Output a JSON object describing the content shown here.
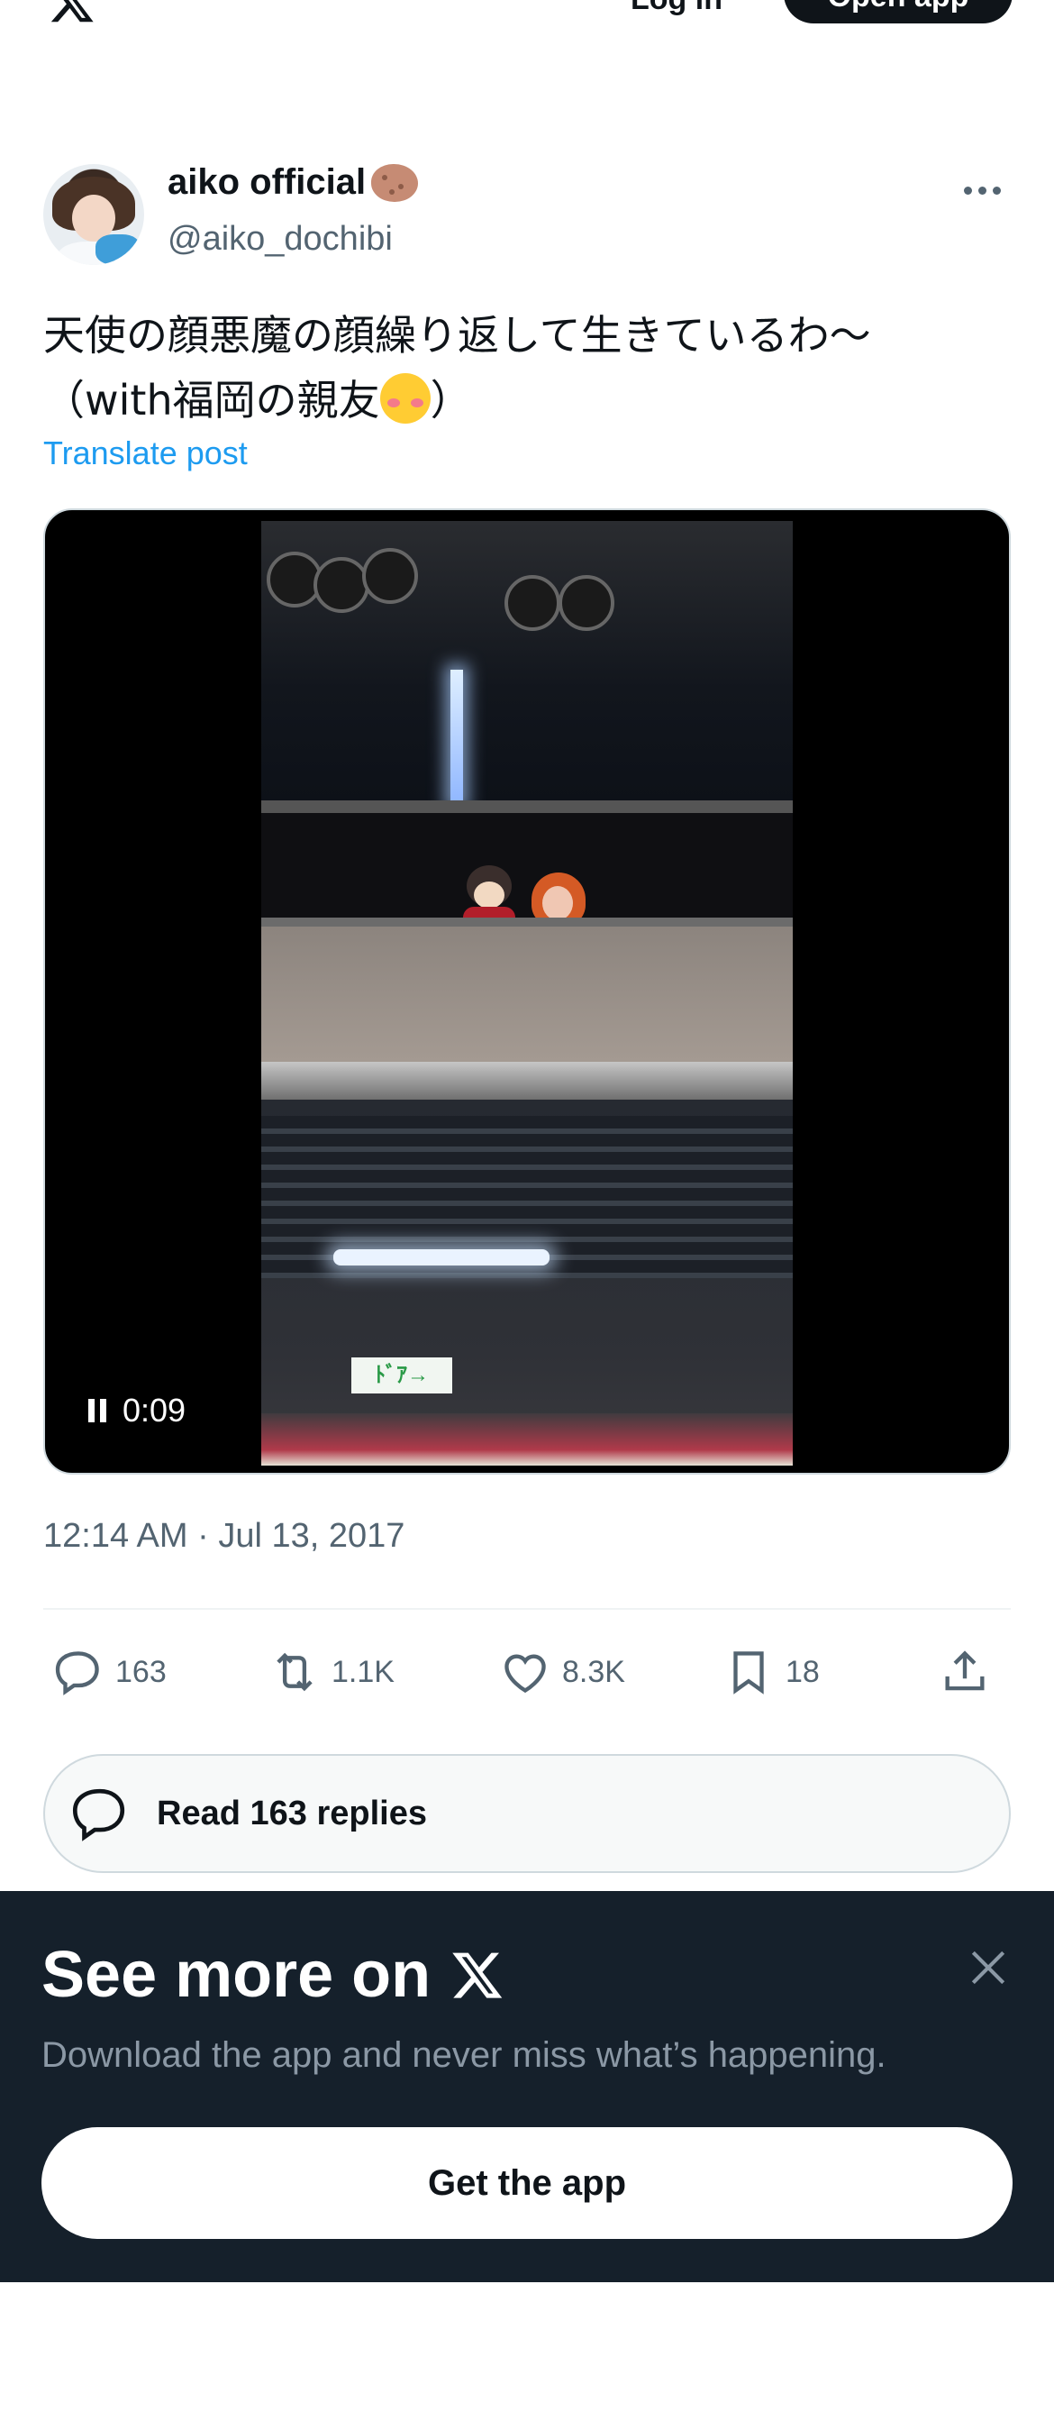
{
  "topbar": {
    "login": "Log in",
    "open_app": "Open app"
  },
  "post": {
    "name": "aiko official",
    "handle": "@aiko_dochibi",
    "text_line1": "天使の顔悪魔の顔繰り返して生きているわ〜",
    "text_line2_prefix": "（with福岡の親友",
    "text_line2_suffix": "）",
    "translate": "Translate post",
    "video_time": "0:09",
    "video_exit_sign": "ﾄﾞｱ→",
    "timestamp": "12:14 AM · Jul 13, 2017",
    "replies": "163",
    "reposts": "1.1K",
    "likes": "8.3K",
    "bookmarks": "18",
    "read_replies": "Read 163 replies"
  },
  "sheet": {
    "title": "See more on",
    "subtitle": "Download the app and never miss what’s happening.",
    "cta": "Get the app"
  }
}
